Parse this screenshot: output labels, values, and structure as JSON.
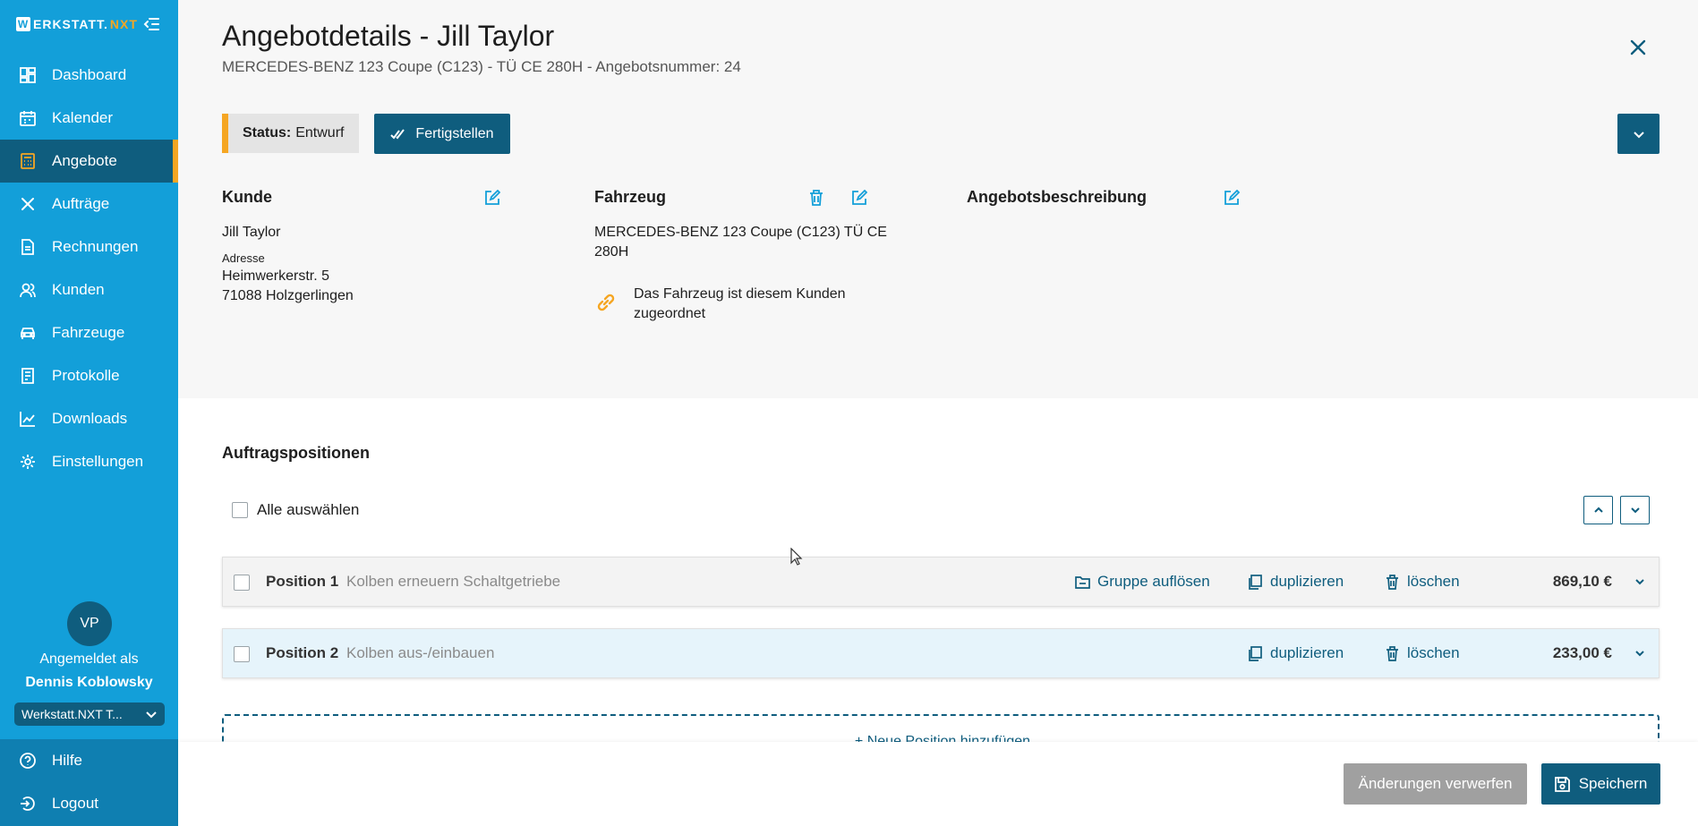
{
  "sidebar": {
    "logo_w": "W",
    "logo_text": "ERKSTATT.",
    "logo_nxt": "NXT",
    "items": [
      {
        "label": "Dashboard",
        "icon": "dashboard-icon"
      },
      {
        "label": "Kalender",
        "icon": "calendar-icon"
      },
      {
        "label": "Angebote",
        "icon": "calculator-icon",
        "active": true
      },
      {
        "label": "Aufträge",
        "icon": "tools-icon"
      },
      {
        "label": "Rechnungen",
        "icon": "document-icon"
      },
      {
        "label": "Kunden",
        "icon": "users-icon"
      },
      {
        "label": "Fahrzeuge",
        "icon": "car-icon"
      },
      {
        "label": "Protokolle",
        "icon": "clipboard-icon"
      },
      {
        "label": "Downloads",
        "icon": "chart-line-icon"
      },
      {
        "label": "Einstellungen",
        "icon": "gear-icon"
      }
    ],
    "user": {
      "initials": "VP",
      "logged_in_as": "Angemeldet als",
      "name": "Dennis Koblowsky",
      "workspace": "Werkstatt.NXT T..."
    },
    "bottom": [
      {
        "label": "Hilfe",
        "icon": "help-icon"
      },
      {
        "label": "Logout",
        "icon": "logout-icon"
      }
    ]
  },
  "header": {
    "title": "Angebotdetails - Jill Taylor",
    "subtitle": "MERCEDES-BENZ 123 Coupe (C123) - TÜ CE 280H - Angebotsnummer: 24"
  },
  "status": {
    "label": "Status:",
    "value": "Entwurf",
    "finish_button": "Fertigstellen"
  },
  "customer": {
    "title": "Kunde",
    "name": "Jill Taylor",
    "address_label": "Adresse",
    "street": "Heimwerkerstr. 5",
    "city": "71088 Holzgerlingen"
  },
  "vehicle": {
    "title": "Fahrzeug",
    "line1": "MERCEDES-BENZ 123 Coupe (C123) TÜ CE",
    "line2": "280H",
    "link_line1": "Das Fahrzeug ist diesem Kunden",
    "link_line2": "zugeordnet"
  },
  "description": {
    "title": "Angebotsbeschreibung"
  },
  "positions": {
    "title": "Auftragspositionen",
    "select_all": "Alle auswählen",
    "rows": [
      {
        "pos": "Position 1",
        "desc": "Kolben erneuern Schaltgetriebe",
        "ungroup": "Gruppe auflösen",
        "duplicate": "duplizieren",
        "delete": "löschen",
        "price": "869,10 €"
      },
      {
        "pos": "Position 2",
        "desc": "Kolben aus-/einbauen",
        "duplicate": "duplizieren",
        "delete": "löschen",
        "price": "233,00 €"
      }
    ],
    "add": "+ Neue Position hinzufügen"
  },
  "footer": {
    "discard": "Änderungen verwerfen",
    "save": "Speichern"
  },
  "colors": {
    "sidebar": "#139fd9",
    "primary": "#0f5d7e",
    "accent": "#f5a623"
  }
}
